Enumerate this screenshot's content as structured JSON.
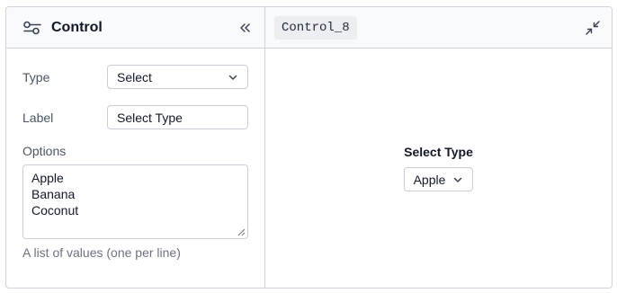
{
  "control_panel": {
    "title": "Control",
    "icons": {
      "title": "sliders-icon",
      "collapse": "double-chevron-left-icon"
    }
  },
  "form": {
    "type_label": "Type",
    "type_value": "Select",
    "label_label": "Label",
    "label_value": "Select Type",
    "options_label": "Options",
    "options": [
      "Apple",
      "Banana",
      "Coconut"
    ],
    "options_hint": "A list of values (one per line)"
  },
  "preview_panel": {
    "control_id": "Control_8",
    "icons": {
      "expand": "minimize-arrows-icon"
    },
    "select_label": "Select Type",
    "select_value": "Apple"
  },
  "colors": {
    "border": "#cfd4dc",
    "header_bg": "#f9fafb",
    "tag_bg": "#eceef1",
    "text": "#111827",
    "muted_text": "#4b5563"
  }
}
